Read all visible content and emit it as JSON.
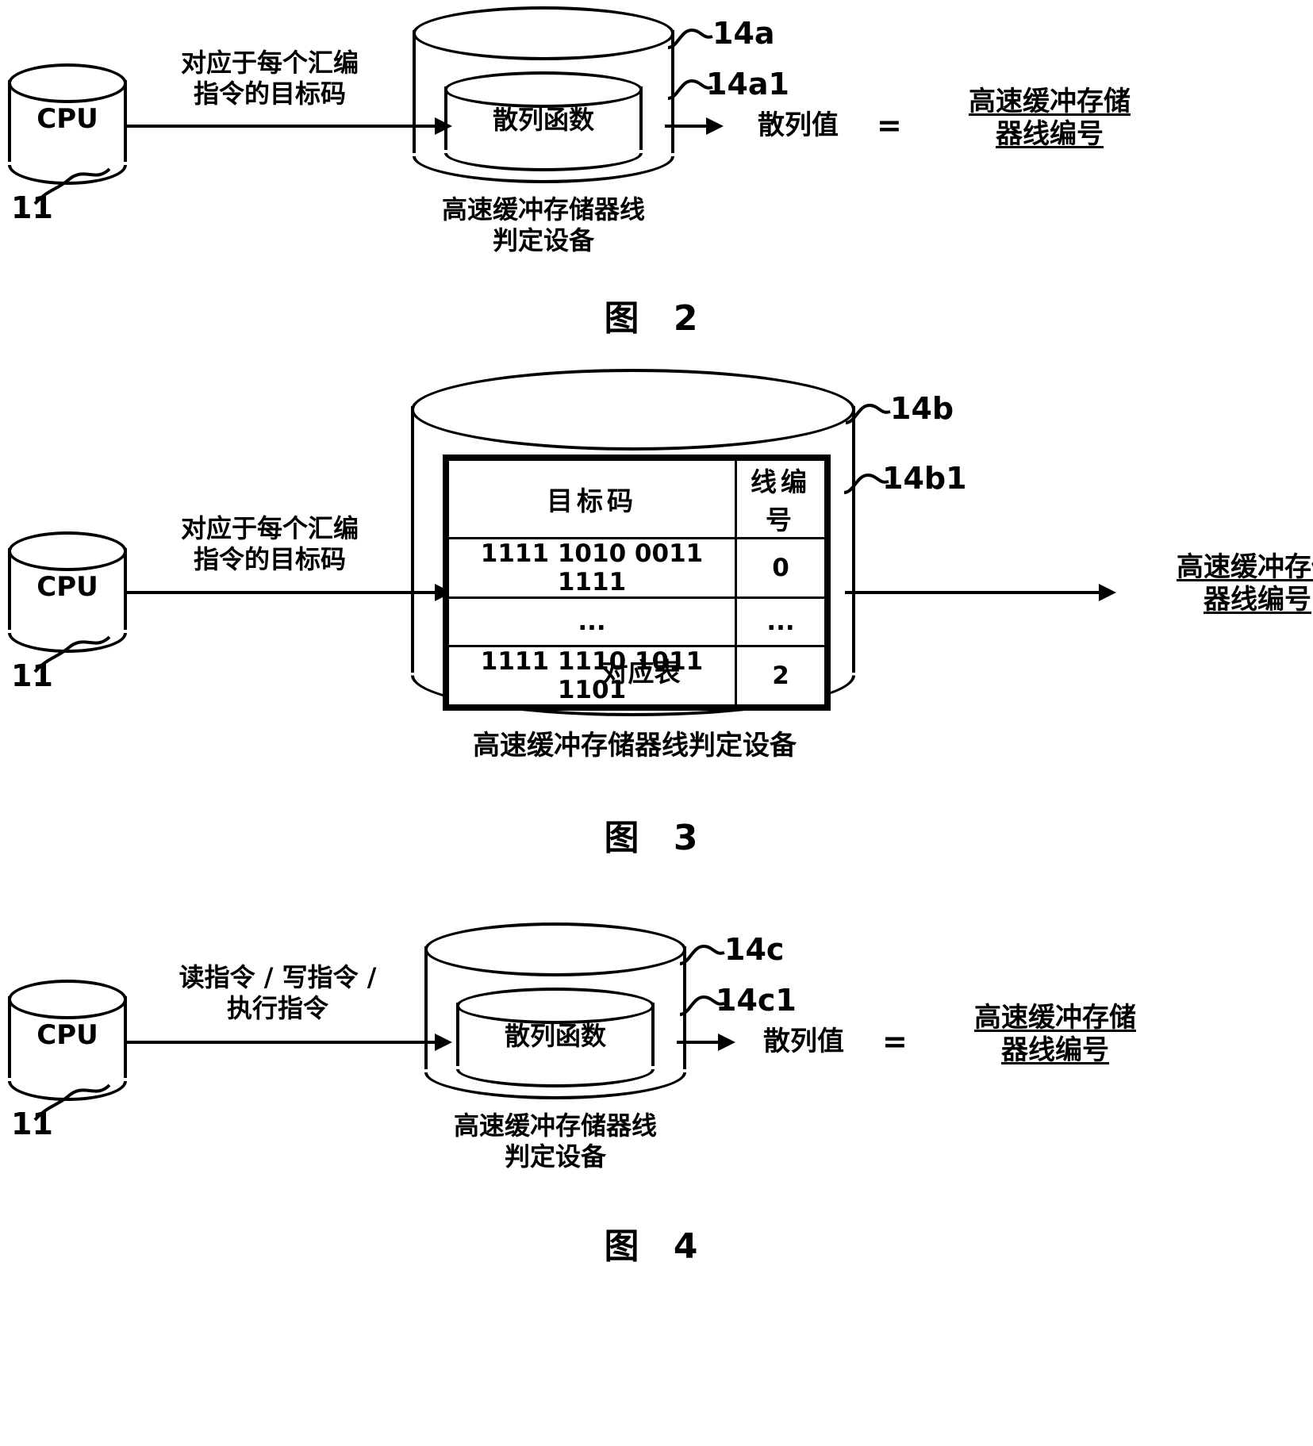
{
  "document": {
    "kind": "patent-drawing-sheet",
    "language": "zh"
  },
  "figures": [
    {
      "id": "fig2",
      "caption": "图 2",
      "cpu": {
        "label": "CPU",
        "ref": "11"
      },
      "arrow_label": "对应于每个汇编\n指令的目标码",
      "outer_cylinder": {
        "ref": "14a"
      },
      "inner_cylinder": {
        "label": "散列函数",
        "ref": "14a1"
      },
      "device_label": "高速缓冲存储器线\n判定设备",
      "output": {
        "value_label": "散列值",
        "equals": "=",
        "result_label": "高速缓冲存储\n器线编号"
      }
    },
    {
      "id": "fig3",
      "caption": "图 3",
      "cpu": {
        "label": "CPU",
        "ref": "11"
      },
      "arrow_label": "对应于每个汇编\n指令的目标码",
      "outer_cylinder": {
        "ref": "14b"
      },
      "table": {
        "ref": "14b1",
        "caption": "对应表",
        "headers": [
          "目标码",
          "线编号"
        ],
        "rows": [
          [
            "1111 1010 0011 1111",
            "0"
          ],
          [
            "...",
            "..."
          ],
          [
            "1111 1110 1011 1101",
            "2"
          ]
        ]
      },
      "device_label": "高速缓冲存储器线判定设备",
      "output": {
        "result_label": "高速缓冲存储\n器线编号"
      }
    },
    {
      "id": "fig4",
      "caption": "图 4",
      "cpu": {
        "label": "CPU",
        "ref": "11"
      },
      "arrow_label": "读指令 / 写指令 /\n执行指令",
      "outer_cylinder": {
        "ref": "14c"
      },
      "inner_cylinder": {
        "label": "散列函数",
        "ref": "14c1"
      },
      "device_label": "高速缓冲存储器线\n判定设备",
      "output": {
        "value_label": "散列值",
        "equals": "=",
        "result_label": "高速缓冲存储\n器线编号"
      }
    }
  ],
  "colors": {
    "ink": "#000000",
    "paper": "#ffffff"
  }
}
